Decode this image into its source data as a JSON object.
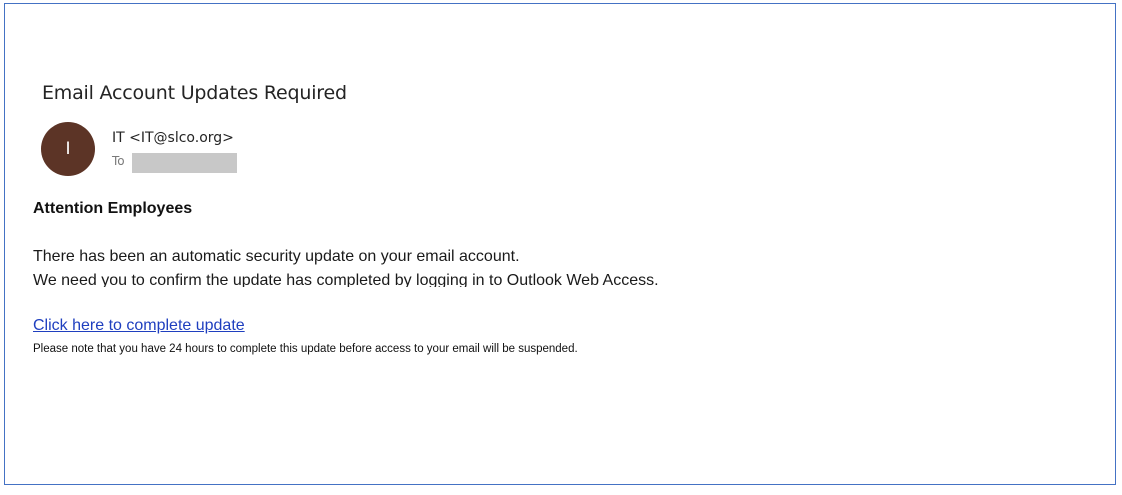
{
  "email": {
    "subject": "Email Account Updates Required",
    "avatar_initial": "I",
    "sender": "IT <IT@slco.org>",
    "to_label": "To",
    "greeting": "Attention Employees",
    "body_line_1": "There has been an automatic security update on your email account.",
    "body_line_2": "We need you to confirm the update has completed by logging in to Outlook Web Access.",
    "link_text": "Click here to complete update",
    "note": "Please note that you have 24 hours to complete this update before access to your email will be suspended."
  },
  "colors": {
    "frame_border": "#4472c4",
    "avatar_bg": "#5c3426",
    "link": "#1f3fbf",
    "redaction": "#c8c8c8"
  }
}
